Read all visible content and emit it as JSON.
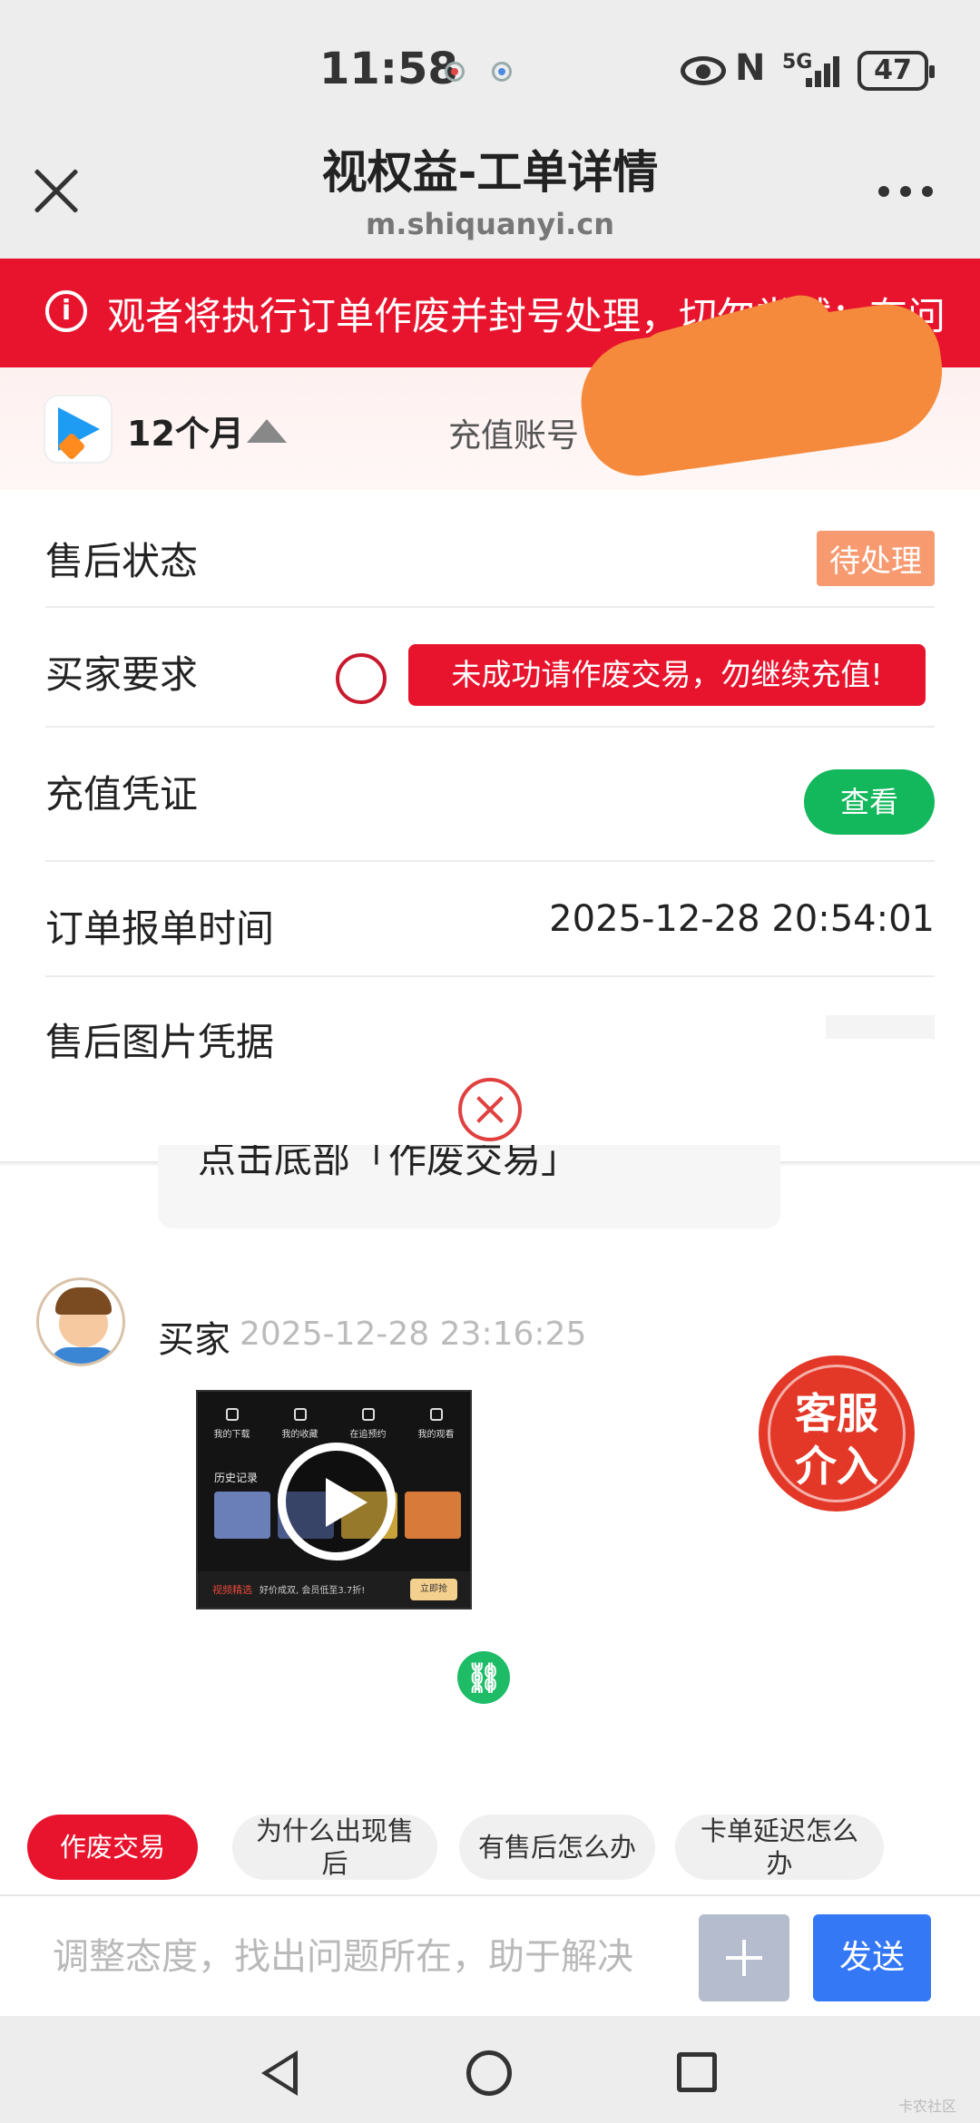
{
  "status_bar": {
    "time": "11:58",
    "network": "5G",
    "nfc": "N",
    "battery": "47"
  },
  "header": {
    "title": "视权益-工单详情",
    "domain": "m.shiquanyi.cn"
  },
  "notice": {
    "text": "观者将执行订单作废并封号处理，切勿尝试；有问"
  },
  "product": {
    "plan": "12个月",
    "account_label": "充值账号"
  },
  "rows": {
    "status": {
      "label": "售后状态",
      "value": "待处理"
    },
    "request": {
      "label": "买家要求",
      "value": "未成功请作废交易，勿继续充值!"
    },
    "proof": {
      "label": "充值凭证",
      "button": "查看"
    },
    "order_time": {
      "label": "订单报单时间",
      "value": "2025-12-28 20:54:01"
    },
    "images": {
      "label": "售后图片凭据"
    }
  },
  "chat": {
    "prev_message": "点击底部「作废交易」",
    "buyer": {
      "name": "买家",
      "time": "2025-12-28 23:16:25"
    },
    "video": {
      "nav": [
        "我的下载",
        "我的收藏",
        "在追预约",
        "我的观看"
      ],
      "history_label": "历史记录",
      "promo_brand": "视频精选",
      "promo_text": "好价成双, 会员低至3.7折!",
      "promo_button": "立即抢"
    },
    "cs_button": {
      "line1": "客服",
      "line2": "介入"
    }
  },
  "chips": [
    {
      "label": "作废交易"
    },
    {
      "label": "为什么出现售后"
    },
    {
      "label": "有售后怎么办"
    },
    {
      "label": "卡单延迟怎么办"
    }
  ],
  "input": {
    "placeholder": "调整态度，找出问题所在，助于解决",
    "send_label": "发送"
  },
  "watermark": "卡农社区",
  "colors": {
    "brand_red": "#e8142d",
    "send_blue": "#3478f6",
    "view_green": "#13b85c",
    "status_orange": "#f79a70"
  }
}
